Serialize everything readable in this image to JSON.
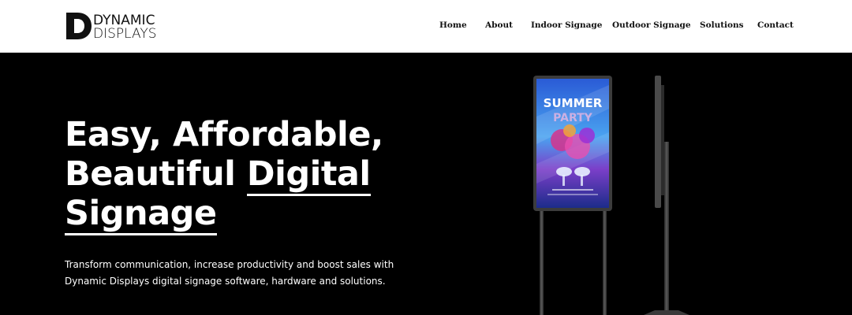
{
  "logo": {
    "line1": "DYNAMIC",
    "line2": "DISPLAYS"
  },
  "nav": {
    "items": [
      "Home",
      "About",
      "Indoor Signage",
      "Outdoor Signage",
      "Solutions",
      "Contact"
    ]
  },
  "hero": {
    "headline_part1": "Easy, Affordable,",
    "headline_part2": "Beautiful ",
    "headline_part3": "Digital",
    "headline_part4": "Signage",
    "subtext": "Transform communication, increase productivity and boost sales with Dynamic Displays digital signage software, hardware and solutions.",
    "screen_title_1": "SUMMER",
    "screen_title_2": "PARTY"
  },
  "colors": {
    "header_bg": "#ffffff",
    "hero_bg": "#000000",
    "text_light": "#ffffff",
    "nav_text": "#111111"
  }
}
